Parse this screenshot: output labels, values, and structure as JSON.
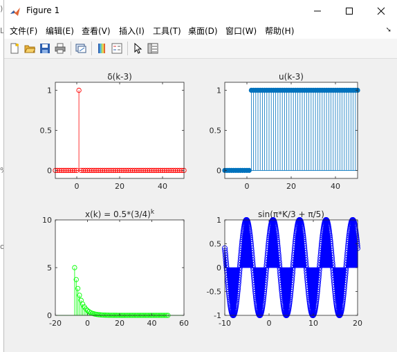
{
  "window": {
    "title": "Figure 1",
    "app_icon": "matlab-logo-icon",
    "controls": [
      "minimize-icon",
      "maximize-icon",
      "close-icon"
    ]
  },
  "menu": {
    "items": [
      "文件(F)",
      "编辑(E)",
      "查看(V)",
      "插入(I)",
      "工具(T)",
      "桌面(D)",
      "窗口(W)",
      "帮助(H)"
    ],
    "more_icon": "chevron-right-icon"
  },
  "toolbar": {
    "icons": [
      "new-figure-icon",
      "open-file-icon",
      "save-icon",
      "print-icon",
      "link-plot-icon",
      "colorbar-icon",
      "legend-icon",
      "pointer-icon",
      "property-inspector-icon"
    ]
  },
  "colors": {
    "red": "#ff0000",
    "blue_default": "#0072bd",
    "green": "#00ff00",
    "blue": "#0000ff",
    "axis": "#262626"
  },
  "chart_data": [
    {
      "type": "stem",
      "title": "δ(k-3)",
      "x_start": -10,
      "x_end": 50,
      "values": "delta at k = 1, 0 elsewhere",
      "xlim": [
        -10,
        50
      ],
      "ylim": [
        -0.1,
        1.1
      ],
      "xticks": [
        0,
        20,
        40
      ],
      "yticks": [
        0,
        0.5,
        1
      ],
      "xtick_labels": [
        "0",
        "20",
        "40"
      ],
      "ytick_labels": [
        "0",
        "0.5",
        "1"
      ],
      "color": "#ff0000",
      "marker": "circle-open"
    },
    {
      "type": "stem",
      "title": "u(k-3)",
      "x_start": -10,
      "x_end": 50,
      "values": "0 for k < 2, 1 for k >= 2",
      "xlim": [
        -10,
        50
      ],
      "ylim": [
        -0.1,
        1.1
      ],
      "xticks": [
        0,
        20,
        40
      ],
      "yticks": [
        0,
        0.5,
        1
      ],
      "xtick_labels": [
        "0",
        "20",
        "40"
      ],
      "ytick_labels": [
        "0",
        "0.5",
        "1"
      ],
      "color": "#0072bd",
      "marker": "circle-filled"
    },
    {
      "type": "stem",
      "title_main": "x(k) = 0.5*(3/4)",
      "title_sup": "k",
      "x_start": -8,
      "x_end": 50,
      "values": "0.5*(0.75)^k",
      "xlim": [
        -20,
        60
      ],
      "ylim": [
        0,
        10
      ],
      "xticks": [
        -20,
        0,
        20,
        40,
        60
      ],
      "yticks": [
        0,
        5,
        10
      ],
      "xtick_labels": [
        "-20",
        "0",
        "20",
        "40",
        "60"
      ],
      "ytick_labels": [
        "0",
        "5",
        "10"
      ],
      "color": "#00ff00",
      "marker": "circle-open"
    },
    {
      "type": "stem",
      "title": "sin(π*K/3 + π/5)",
      "x_start": -10,
      "x_end": 20,
      "x_step": 0.05,
      "values": "sin(pi*k/3 + pi/5)",
      "xlim": [
        -10,
        20
      ],
      "ylim": [
        -1,
        1
      ],
      "xticks": [
        -10,
        0,
        10,
        20
      ],
      "yticks": [
        -1,
        -0.5,
        0,
        0.5,
        1
      ],
      "xtick_labels": [
        "-10",
        "0",
        "10",
        "20"
      ],
      "ytick_labels": [
        "-1",
        "-0.5",
        "0",
        "0.5",
        "1"
      ],
      "color": "#0000ff",
      "marker": "circle-open"
    }
  ]
}
